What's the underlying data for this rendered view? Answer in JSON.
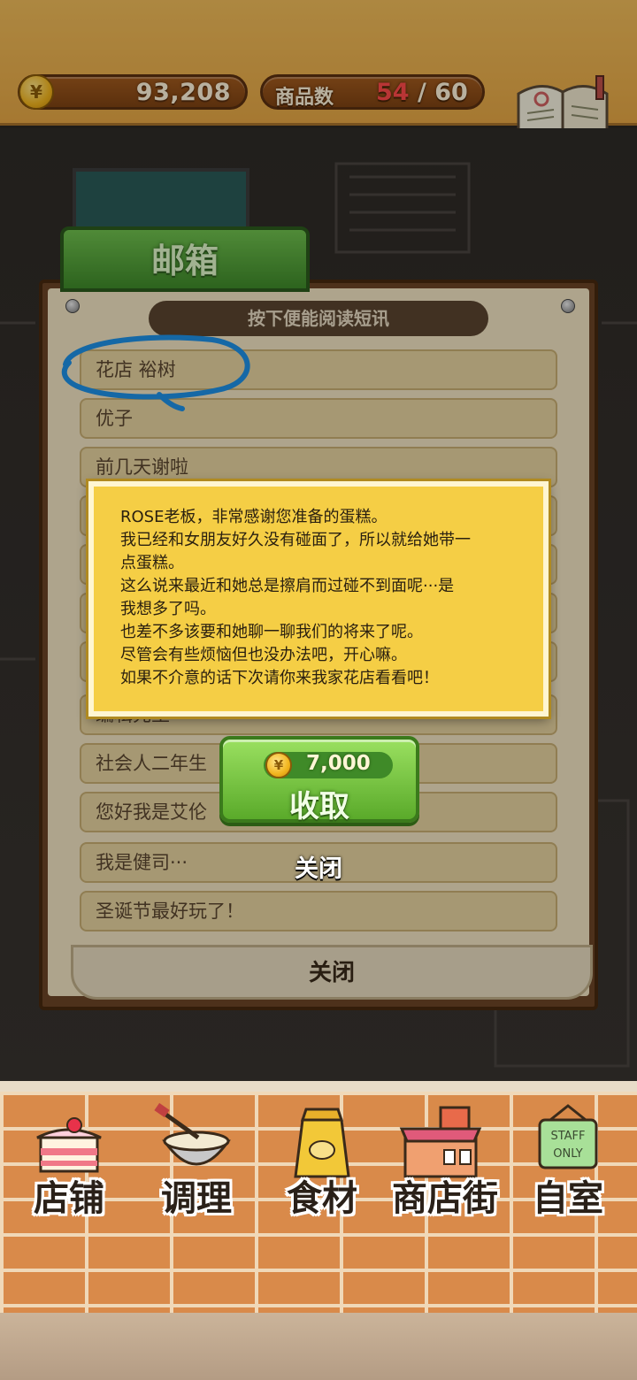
{
  "status": {
    "money": "93,208",
    "coin_symbol": "¥",
    "product_count_label": "商品数",
    "product_count_current": "54",
    "product_count_separator": "/",
    "product_count_max": "60",
    "recipe_label": "食谱"
  },
  "mailbox": {
    "tab_title": "邮箱",
    "hint": "按下便能阅读短讯",
    "messages": [
      "花店 裕树",
      "优子",
      "前几天谢啦",
      "",
      "",
      "",
      "",
      "编辑先生",
      "社会人二年生",
      "您好我是艾伦",
      "我是健司···",
      "圣诞节最好玩了！"
    ],
    "close_label": "关闭"
  },
  "popup": {
    "lines": [
      "ROSE老板，非常感谢您准备的蛋糕。",
      "我已经和女朋友好久没有碰面了，所以就给她带一",
      "点蛋糕。",
      "这么说来最近和她总是擦肩而过碰不到面呢···是",
      "我想多了吗。",
      "也差不多该要和她聊一聊我们的将来了呢。",
      "尽管会有些烦恼但也没办法吧，开心嘛。",
      "如果不介意的话下次请你来我家花店看看吧！"
    ],
    "reward_amount": "7,000",
    "collect_label": "收取",
    "close_label": "关闭"
  },
  "nav": {
    "items": [
      {
        "label": "店铺",
        "icon": "cake-icon"
      },
      {
        "label": "调理",
        "icon": "mixing-bowl-icon"
      },
      {
        "label": "食材",
        "icon": "ingredients-bag-icon"
      },
      {
        "label": "商店街",
        "icon": "shop-street-icon"
      },
      {
        "label": "自室",
        "icon": "staff-only-sign-icon"
      }
    ]
  },
  "colors": {
    "accent_gold": "#f0bc5a",
    "popup_yellow": "#f5ce45",
    "button_green": "#5aaa2a",
    "count_red": "#ff4a4a",
    "annotation_blue": "#1e90e6"
  }
}
